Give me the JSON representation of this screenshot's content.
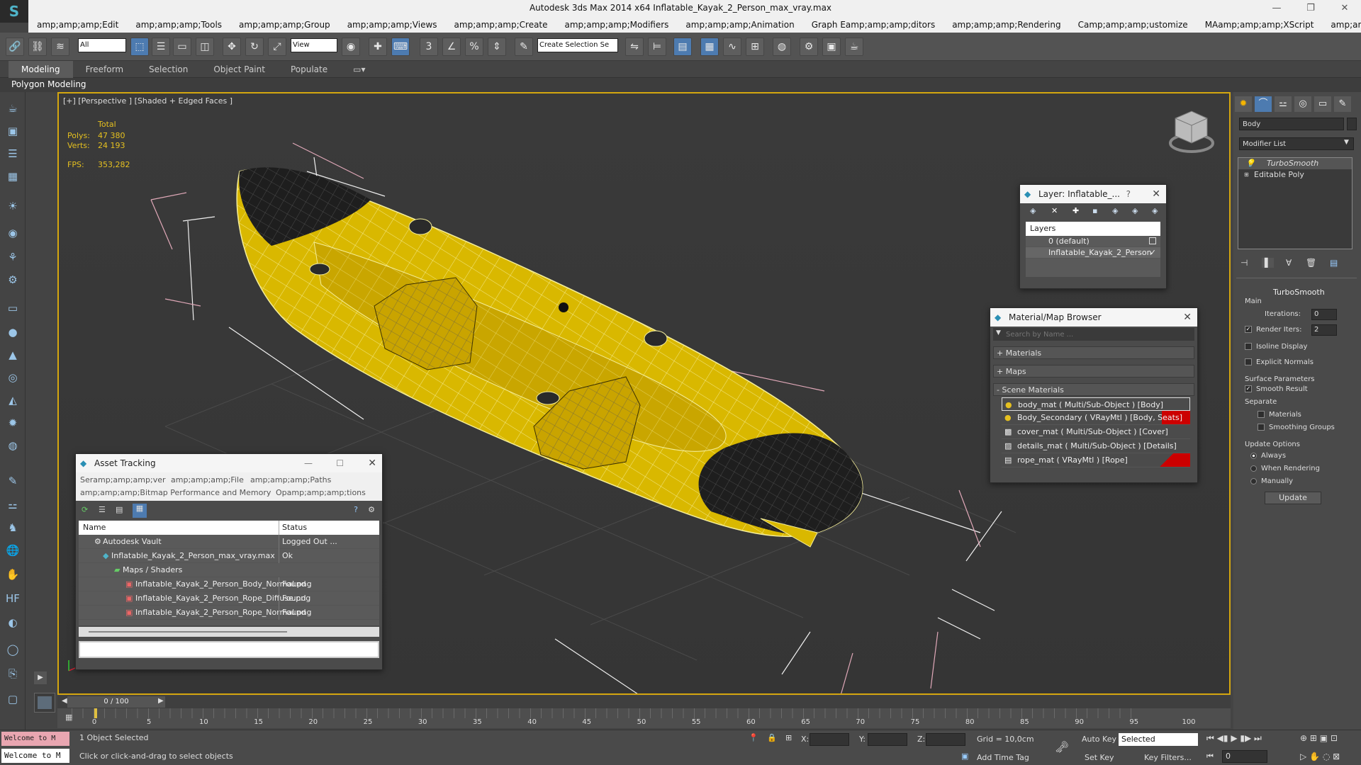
{
  "window": {
    "title": "Autodesk 3ds Max  2014 x64     Inflatable_Kayak_2_Person_max_vray.max",
    "buttons": [
      "—",
      "❐",
      "✕"
    ]
  },
  "menu": [
    "amp;amp;amp;Edit",
    "amp;amp;amp;Tools",
    "amp;amp;amp;Group",
    "amp;amp;amp;Views",
    "amp;amp;amp;Create",
    "amp;amp;amp;Modifiers",
    "amp;amp;amp;Animation",
    "Graph Eamp;amp;amp;ditors",
    "amp;amp;amp;Rendering",
    "Camp;amp;amp;ustomize",
    "MAamp;amp;amp;XScript",
    "amp;amp;amp;Help"
  ],
  "toolbar": {
    "filter_value": "All",
    "refcoord_value": "View",
    "selection_set_value": "Create Selection Se"
  },
  "ribbon": {
    "tabs": [
      "Modeling",
      "Freeform",
      "Selection",
      "Object Paint",
      "Populate"
    ],
    "sub_label": "Polygon Modeling"
  },
  "viewport": {
    "label": "[+] [Perspective ] [Shaded + Edged Faces ]",
    "stats": {
      "total_label": "Total",
      "polys_label": "Polys:",
      "polys_value": "47 380",
      "verts_label": "Verts:",
      "verts_value": "24 193",
      "fps_label": "FPS:",
      "fps_value": "353,282"
    },
    "colors": {
      "hull": "#d9b800",
      "wire": "#f5ee9a",
      "dark": "#1e1e1e",
      "selection": "#e0a8b8"
    }
  },
  "layer_window": {
    "title": "Layer: Inflatable_...",
    "help": "?",
    "header": "Layers",
    "layers": [
      "0 (default)",
      "Inflatable_Kayak_2_Person"
    ]
  },
  "material_browser": {
    "title": "Material/Map Browser",
    "search_placeholder": "Search by Name ...",
    "groups": [
      "+ Materials",
      "+ Maps",
      "- Scene Materials"
    ],
    "materials": [
      "body_mat  ( Multi/Sub-Object ) [Body]",
      "Body_Secondary  ( VRayMtl ) [Body, Seats]",
      "cover_mat  ( Multi/Sub-Object ) [Cover]",
      "details_mat  ( Multi/Sub-Object ) [Details]",
      "rope_mat  ( VRayMtl ) [Rope]"
    ]
  },
  "asset_tracking": {
    "title": "Asset Tracking",
    "menu_row1": [
      "Seramp;amp;amp;ver",
      "amp;amp;amp;File",
      "amp;amp;amp;Paths"
    ],
    "menu_row2": [
      "amp;amp;amp;Bitmap Performance and Memory",
      "Opamp;amp;amp;tions"
    ],
    "columns": [
      "Name",
      "Status"
    ],
    "rows": [
      {
        "name": "Autodesk Vault",
        "status": "Logged Out ..."
      },
      {
        "name": "Inflatable_Kayak_2_Person_max_vray.max",
        "status": "Ok"
      },
      {
        "name": "Maps / Shaders",
        "status": ""
      },
      {
        "name": "Inflatable_Kayak_2_Person_Body_Normal.png",
        "status": "Found"
      },
      {
        "name": "Inflatable_Kayak_2_Person_Rope_Diffuse.png",
        "status": "Found"
      },
      {
        "name": "Inflatable_Kayak_2_Person_Rope_Normal.png",
        "status": "Found"
      }
    ]
  },
  "command_panel": {
    "object_name": "Body",
    "modifier_list": "Modifier List",
    "stack": [
      "TurboSmooth",
      "Editable Poly"
    ],
    "rollout_title": "TurboSmooth",
    "main_label": "Main",
    "iterations_label": "Iterations:",
    "iterations_value": "0",
    "render_iters_label": "Render Iters:",
    "render_iters_value": "2",
    "isoline_label": "Isoline Display",
    "explicit_normals_label": "Explicit Normals",
    "surface_params_label": "Surface Parameters",
    "smooth_result_label": "Smooth Result",
    "separate_label": "Separate",
    "materials_label": "Materials",
    "smoothing_groups_label": "Smoothing Groups",
    "update_options_label": "Update Options",
    "always_label": "Always",
    "when_rendering_label": "When Rendering",
    "manually_label": "Manually",
    "update_button": "Update"
  },
  "timeline": {
    "frame_label": "0 / 100",
    "ticks": [
      "0",
      "5",
      "10",
      "15",
      "20",
      "25",
      "30",
      "35",
      "40",
      "45",
      "50",
      "55",
      "60",
      "65",
      "70",
      "75",
      "80",
      "85",
      "90",
      "95",
      "100"
    ]
  },
  "status": {
    "maxscript_text": "Welcome to M",
    "selection_text": "1 Object Selected",
    "prompt_text": "Click or click-and-drag to select objects",
    "x_label": "X:",
    "y_label": "Y:",
    "z_label": "Z:",
    "grid_text": "Grid = 10,0cm",
    "add_time_tag": "Add Time Tag",
    "auto_key": "Auto Key",
    "set_key": "Set Key",
    "selected_value": "Selected",
    "key_filters": "Key Filters...",
    "frame_value": "0"
  }
}
